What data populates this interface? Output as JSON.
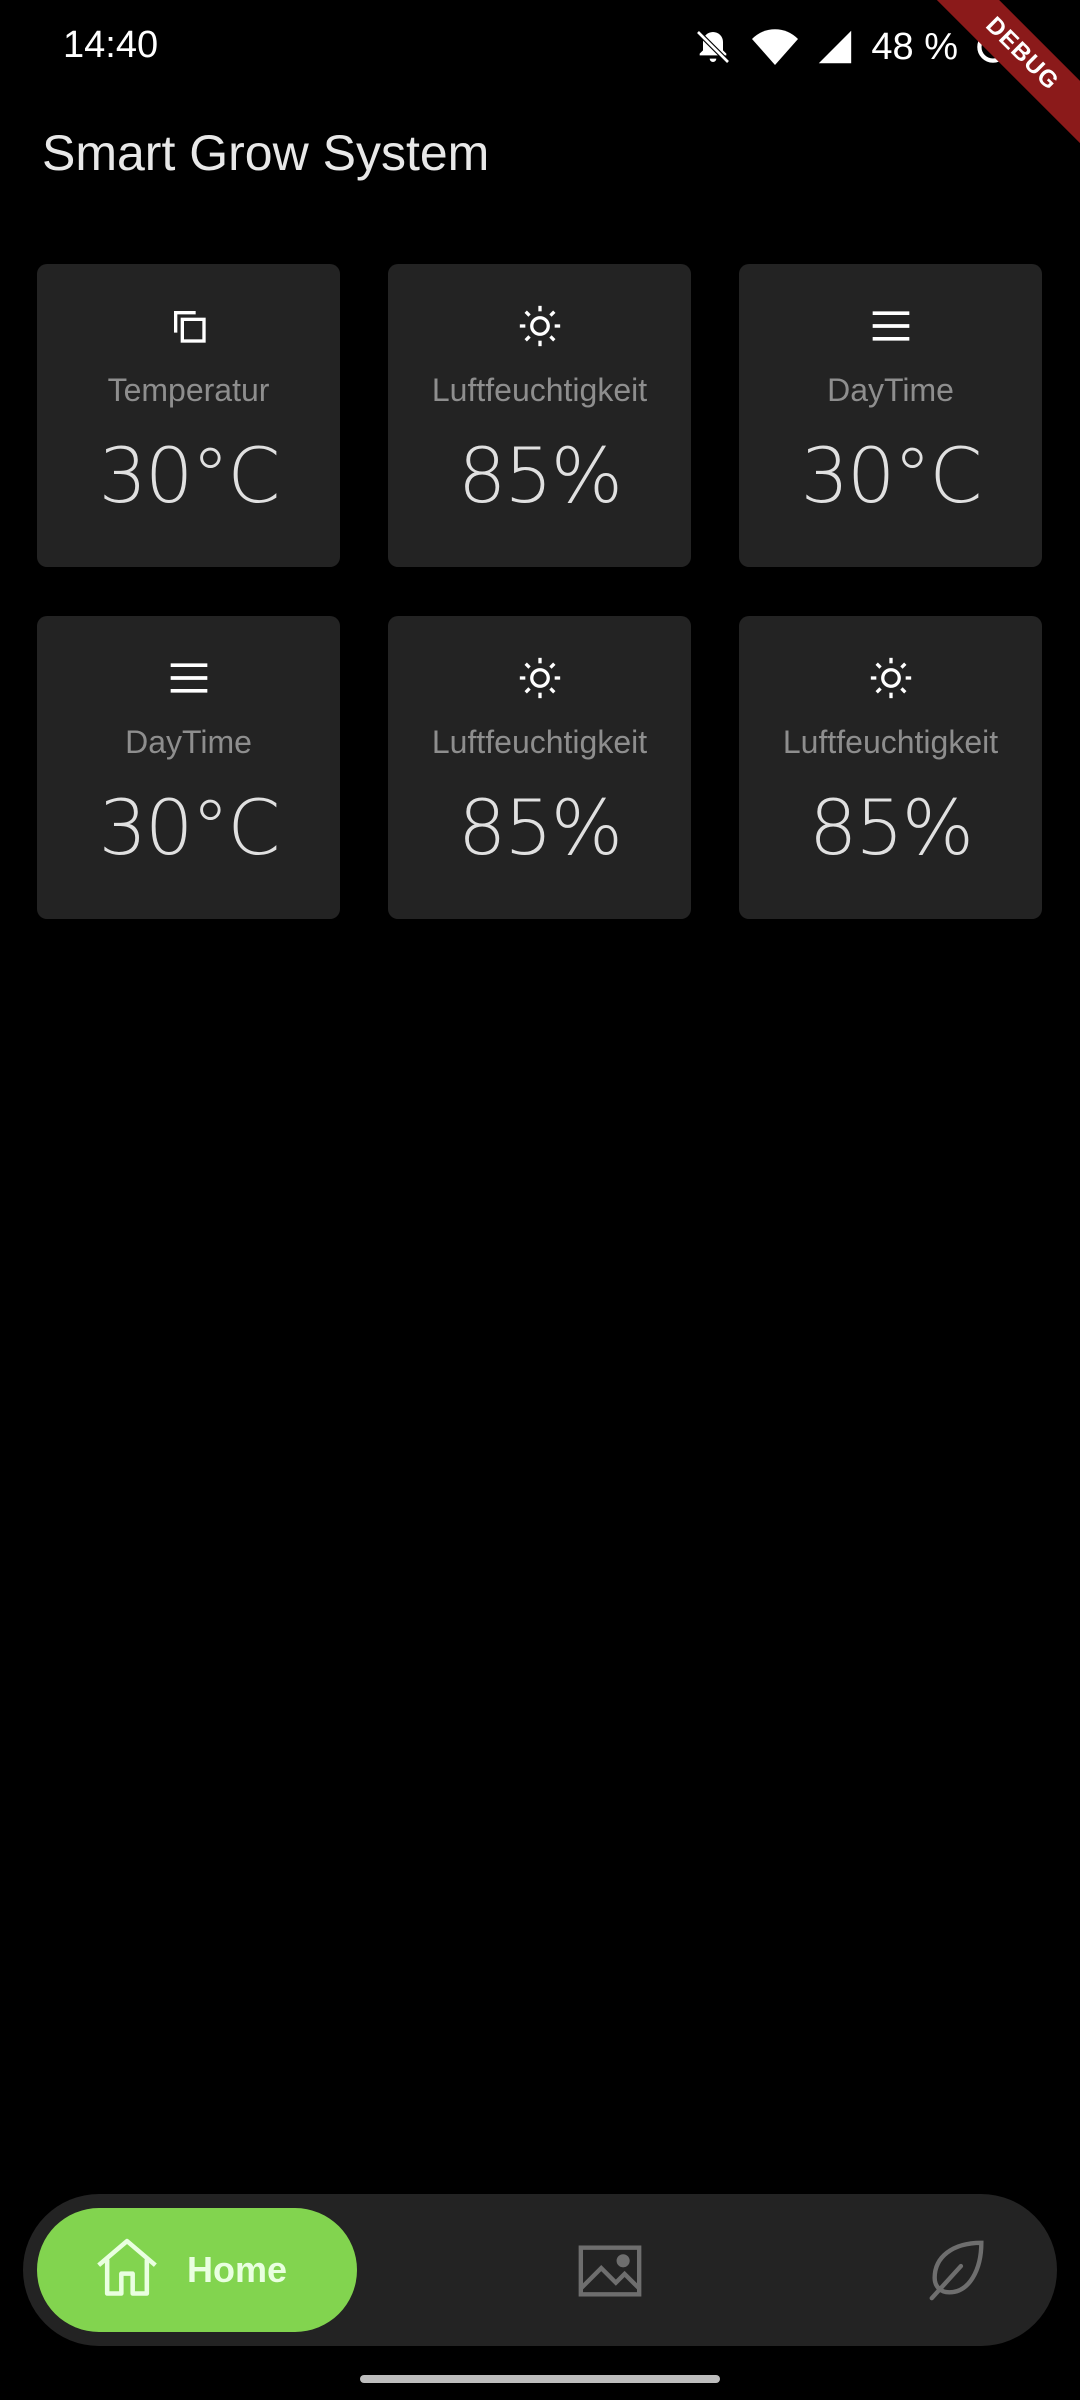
{
  "status_bar": {
    "time": "14:40",
    "battery": "48 %"
  },
  "debug_banner": "DEBUG",
  "app": {
    "title": "Smart Grow System"
  },
  "cards": [
    {
      "icon": "copy-icon",
      "label": "Temperatur",
      "value": "30°C"
    },
    {
      "icon": "sun-icon",
      "label": "Luftfeuchtigkeit",
      "value": "85%"
    },
    {
      "icon": "menu-icon",
      "label": "DayTime",
      "value": "30°C"
    },
    {
      "icon": "menu-icon",
      "label": "DayTime",
      "value": "30°C"
    },
    {
      "icon": "sun-icon",
      "label": "Luftfeuchtigkeit",
      "value": "85%"
    },
    {
      "icon": "sun-icon",
      "label": "Luftfeuchtigkeit",
      "value": "85%"
    }
  ],
  "bottom_nav": {
    "home_label": "Home",
    "accent_color": "#82d44f",
    "items": [
      {
        "icon": "home-icon",
        "selected": true
      },
      {
        "icon": "image-icon",
        "selected": false
      },
      {
        "icon": "leaf-icon",
        "selected": false
      }
    ]
  },
  "colors": {
    "background": "#000000",
    "card": "#232323",
    "accent": "#82d44f",
    "debug": "#8b1a1a"
  }
}
